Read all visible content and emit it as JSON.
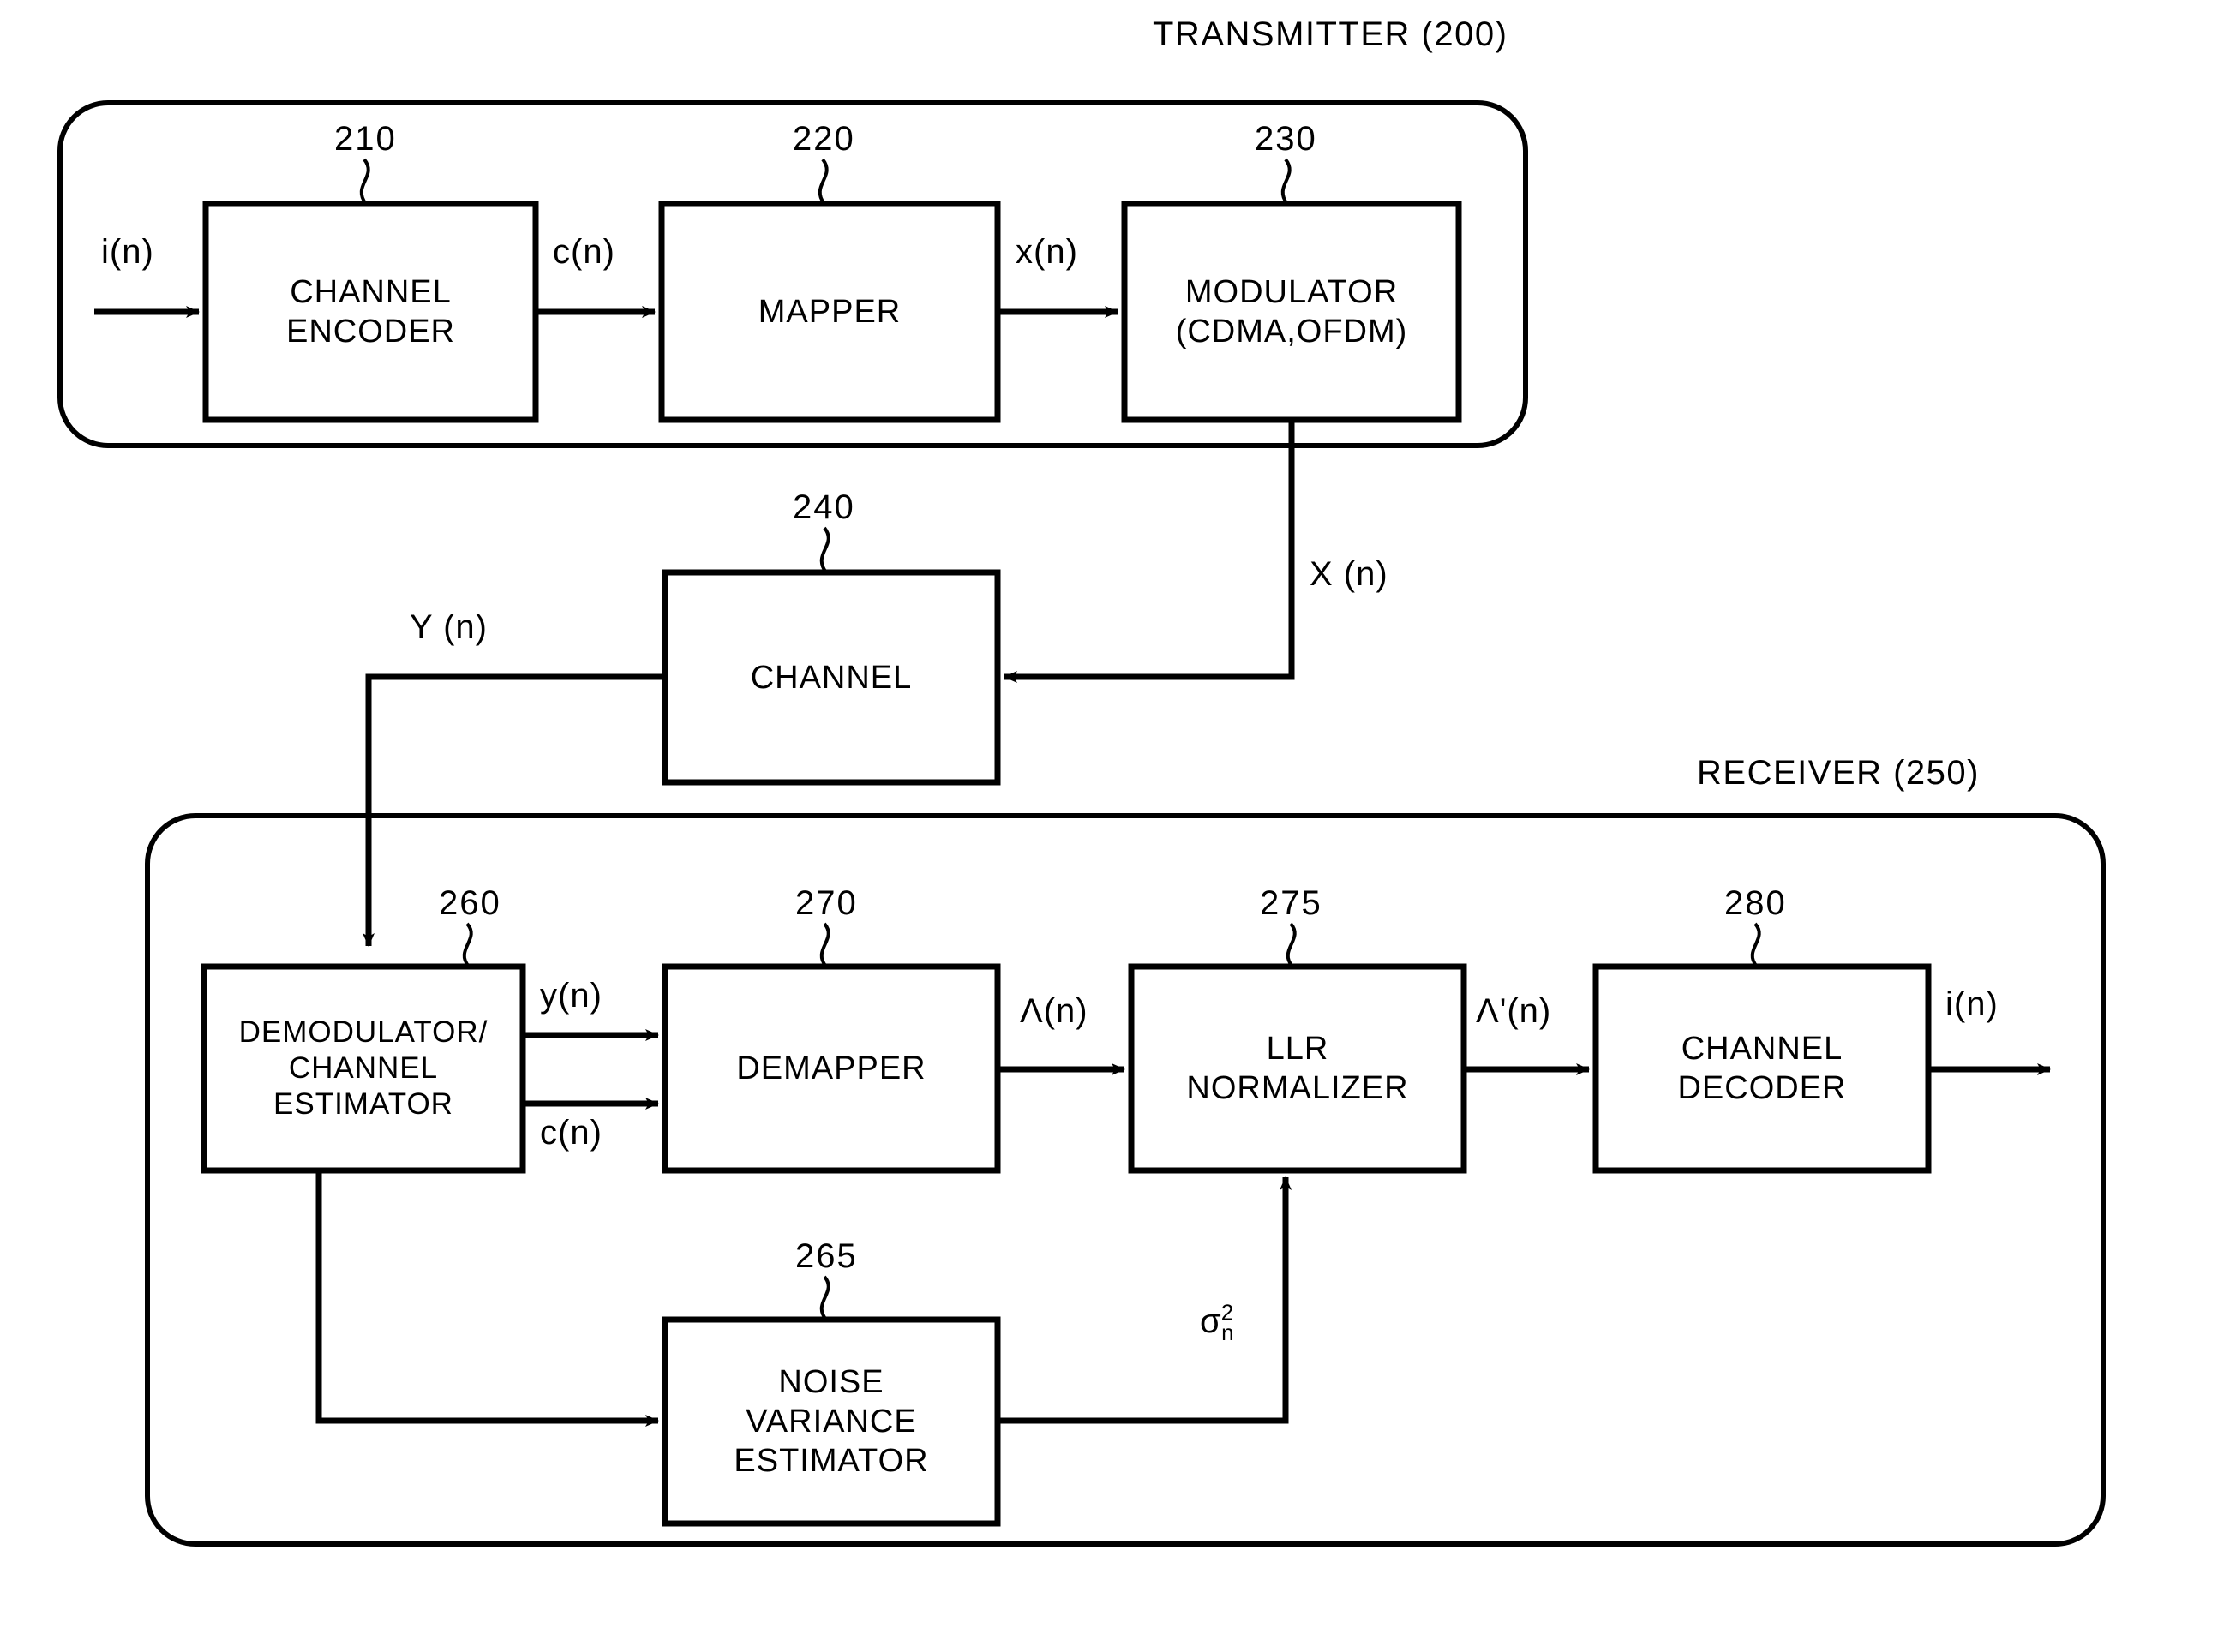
{
  "figure": {
    "type": "block-diagram",
    "sections": [
      {
        "id": "transmitter",
        "caption": "TRANSMITTER (200)"
      },
      {
        "id": "receiver",
        "caption": "RECEIVER (250)"
      }
    ]
  },
  "transmitter": {
    "caption": "TRANSMITTER (200)",
    "blocks": [
      {
        "ref": "210",
        "lines": [
          "CHANNEL",
          "ENCODER"
        ]
      },
      {
        "ref": "220",
        "lines": [
          "MAPPER"
        ]
      },
      {
        "ref": "230",
        "lines": [
          "MODULATOR",
          "(CDMA,OFDM)"
        ]
      }
    ],
    "signals": {
      "input": "i(n)",
      "encoder_out": "c(n)",
      "mapper_out": "x(n)"
    }
  },
  "channel": {
    "block": {
      "ref": "240",
      "lines": [
        "CHANNEL"
      ]
    },
    "signals": {
      "in": "X (n)",
      "out": "Y (n)"
    }
  },
  "receiver": {
    "caption": "RECEIVER (250)",
    "blocks": [
      {
        "ref": "260",
        "lines": [
          "DEMODULATOR/",
          "CHANNEL",
          "ESTIMATOR"
        ]
      },
      {
        "ref": "270",
        "lines": [
          "DEMAPPER"
        ]
      },
      {
        "ref": "275",
        "lines": [
          "LLR",
          "NORMALIZER"
        ]
      },
      {
        "ref": "280",
        "lines": [
          "CHANNEL",
          "DECODER"
        ]
      },
      {
        "ref": "265",
        "lines": [
          "NOISE",
          "VARIANCE",
          "ESTIMATOR"
        ]
      }
    ],
    "signals": {
      "demod_y": "y(n)",
      "demod_c": "c(n)",
      "demapper_out": "Λ(n)",
      "llr_out": "Λ'(n)",
      "decoder_out": "i(n)",
      "noise_variance_base": "σ",
      "noise_variance_sup": "2",
      "noise_variance_sub": "n"
    }
  },
  "colors": {
    "ink": "#000000",
    "paper": "#ffffff"
  }
}
